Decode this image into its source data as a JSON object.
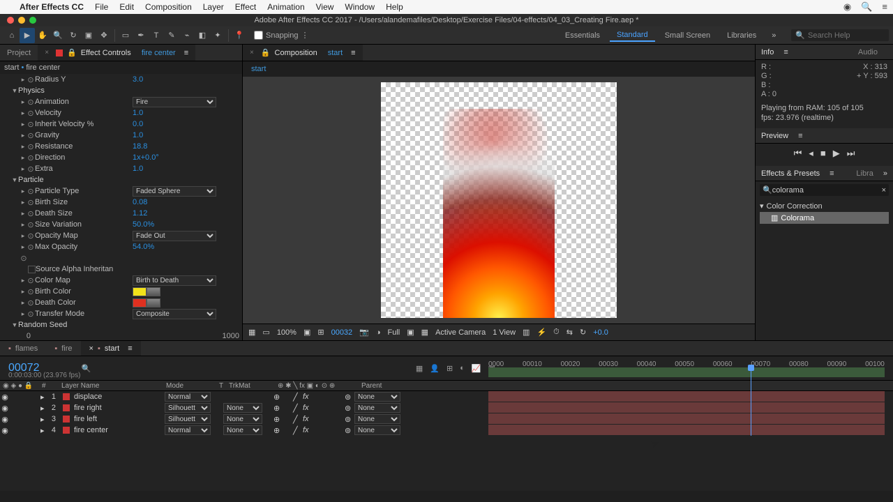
{
  "menubar": {
    "app": "After Effects CC",
    "items": [
      "File",
      "Edit",
      "Composition",
      "Layer",
      "Effect",
      "Animation",
      "View",
      "Window",
      "Help"
    ]
  },
  "window_title": "Adobe After Effects CC 2017 - /Users/alandemafiles/Desktop/Exercise Files/04-effects/04_03_Creating Fire.aep *",
  "toolbar": {
    "snapping_label": "Snapping"
  },
  "workspaces": {
    "items": [
      "Essentials",
      "Standard",
      "Small Screen",
      "Libraries"
    ],
    "active": "Standard",
    "search_placeholder": "Search Help"
  },
  "left_panel": {
    "tab_project": "Project",
    "tab_effect_controls": "Effect Controls",
    "tab_effect_target": "fire center",
    "crumb_comp": "start",
    "crumb_layer": "fire center",
    "props": [
      {
        "type": "prop",
        "indent": 2,
        "name": "Radius Y",
        "value": "3.0"
      },
      {
        "type": "group",
        "indent": 1,
        "name": "Physics"
      },
      {
        "type": "dropdown",
        "indent": 2,
        "name": "Animation",
        "value": "Fire"
      },
      {
        "type": "prop",
        "indent": 2,
        "name": "Velocity",
        "value": "1.0"
      },
      {
        "type": "prop",
        "indent": 2,
        "name": "Inherit Velocity %",
        "value": "0.0"
      },
      {
        "type": "prop",
        "indent": 2,
        "name": "Gravity",
        "value": "1.0"
      },
      {
        "type": "prop",
        "indent": 2,
        "name": "Resistance",
        "value": "18.8"
      },
      {
        "type": "prop",
        "indent": 2,
        "name": "Direction",
        "value": "1x+0.0°"
      },
      {
        "type": "prop",
        "indent": 2,
        "name": "Extra",
        "value": "1.0"
      },
      {
        "type": "group",
        "indent": 1,
        "name": "Particle"
      },
      {
        "type": "dropdown",
        "indent": 2,
        "name": "Particle Type",
        "value": "Faded Sphere"
      },
      {
        "type": "prop",
        "indent": 2,
        "name": "Birth Size",
        "value": "0.08"
      },
      {
        "type": "prop",
        "indent": 2,
        "name": "Death Size",
        "value": "1.12"
      },
      {
        "type": "prop",
        "indent": 2,
        "name": "Size Variation",
        "value": "50.0%"
      },
      {
        "type": "dropdown",
        "indent": 2,
        "name": "Opacity Map",
        "value": "Fade Out"
      },
      {
        "type": "prop",
        "indent": 2,
        "name": "Max Opacity",
        "value": "54.0%"
      },
      {
        "type": "blank",
        "indent": 2
      },
      {
        "type": "dropdown",
        "indent": 2,
        "name": "Color Map",
        "value": "Birth to Death"
      },
      {
        "type": "color",
        "indent": 2,
        "name": "Birth Color",
        "color": "#f2e21a"
      },
      {
        "type": "color",
        "indent": 2,
        "name": "Death Color",
        "color": "#e03020"
      },
      {
        "type": "dropdown",
        "indent": 2,
        "name": "Transfer Mode",
        "value": "Composite"
      },
      {
        "type": "group",
        "indent": 1,
        "name": "Random Seed"
      },
      {
        "type": "slider",
        "min": "0",
        "max": "1000",
        "value": "0"
      }
    ],
    "checkbox_label": "Source Alpha Inheritan"
  },
  "center_panel": {
    "tab_label": "Composition",
    "tab_target": "start",
    "subtab": "start",
    "footer": {
      "zoom": "100%",
      "frame": "00032",
      "res": "Full",
      "camera": "Active Camera",
      "views": "1 View",
      "exposure": "+0.0"
    }
  },
  "right_panel": {
    "info_tab": "Info",
    "audio_tab": "Audio",
    "rgb": {
      "r": "R :",
      "g": "G :",
      "b": "B :",
      "a": "A : 0"
    },
    "xy": {
      "x": "X : 313",
      "y": "Y : 593"
    },
    "play_msg": "Playing from RAM: 105 of 105\nfps: 23.976 (realtime)",
    "preview_tab": "Preview",
    "ep_tab": "Effects & Presets",
    "libra_tab": "Libra",
    "ep_search": "colorama",
    "ep_group": "Color Correction",
    "ep_item": "Colorama"
  },
  "timeline": {
    "tabs": [
      "flames",
      "fire",
      "start"
    ],
    "active": "start",
    "timecode": "00072",
    "subtime": "0:00:03:00 (23.976 fps)",
    "cols": {
      "layer": "Layer Name",
      "mode": "Mode",
      "trkmat": "TrkMat",
      "parent": "Parent"
    },
    "ruler": [
      "0000",
      "00010",
      "00020",
      "00030",
      "00040",
      "00050",
      "00060",
      "00070",
      "00080",
      "00090",
      "00100"
    ],
    "layers": [
      {
        "n": "1",
        "name": "displace",
        "mode": "Normal",
        "trk": "",
        "parent": "None"
      },
      {
        "n": "2",
        "name": "fire right",
        "mode": "Silhouett",
        "trk": "None",
        "parent": "None"
      },
      {
        "n": "3",
        "name": "fire left",
        "mode": "Silhouett",
        "trk": "None",
        "parent": "None"
      },
      {
        "n": "4",
        "name": "fire center",
        "mode": "Normal",
        "trk": "None",
        "parent": "None"
      }
    ]
  }
}
